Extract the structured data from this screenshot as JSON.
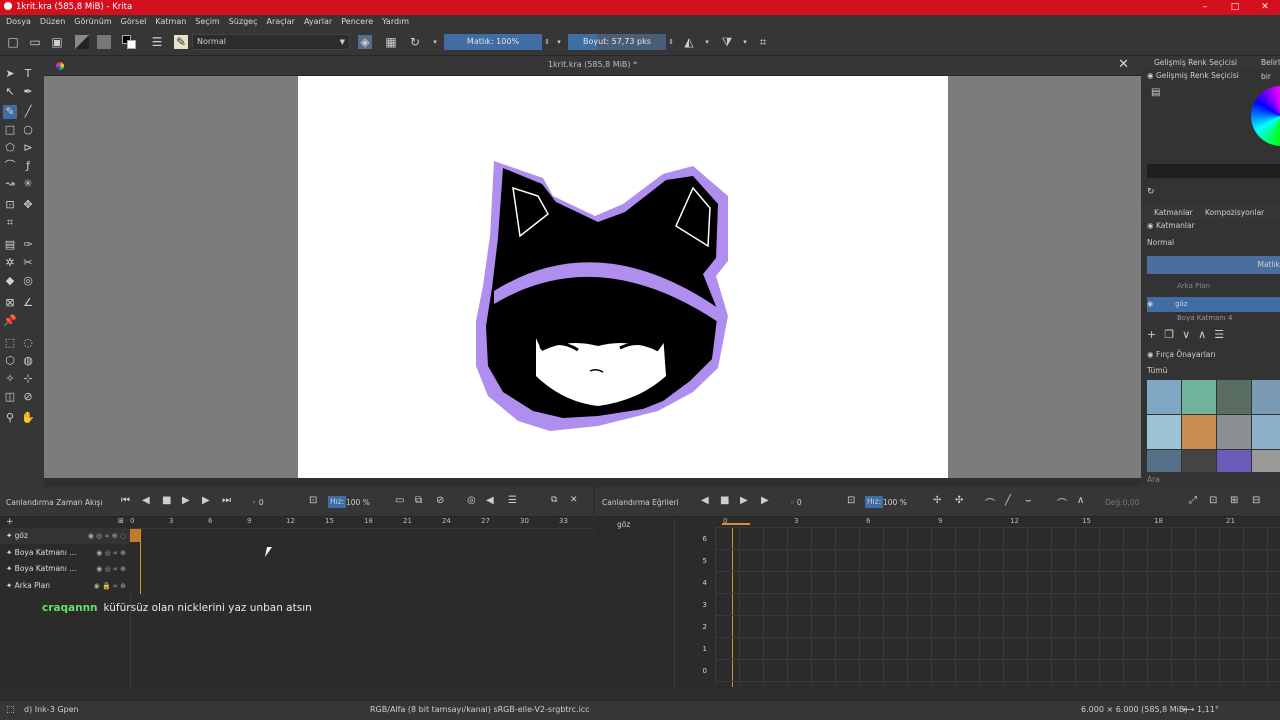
{
  "window": {
    "title": "1krit.kra (585,8 MiB) - Krita",
    "controls": [
      "–",
      "□",
      "✕"
    ]
  },
  "menu": [
    "Dosya",
    "Düzen",
    "Görünüm",
    "Görsel",
    "Katman",
    "Seçim",
    "Süzgeç",
    "Araçlar",
    "Ayarlar",
    "Pencere",
    "Yardım"
  ],
  "toolbar": {
    "blend_mode": "Normal",
    "opacity_label": "Matlık: 100%",
    "opacity_value": 1.0,
    "size_label": "Boyut: 57,73 pks",
    "size_fill": 0.3
  },
  "document": {
    "tab_title": "1krit.kra (585,8 MiB) *"
  },
  "right_dock": {
    "advanced_color_tab": "Gelişmiş Renk Seçicisi",
    "specific_color_tab": "Belirli bir",
    "advanced_color_header": "Gelişmiş Renk Seçicisi",
    "layers_tab": "Katmanlar",
    "composition_tab": "Kompozisyonlar",
    "layers_header": "Katmanlar",
    "blend": "Normal",
    "opacity": "Matlık",
    "layers": [
      "Arka Plan",
      "göz",
      "Boya Katmanı 4"
    ],
    "brush_presets_header": "Fırça Önayarları",
    "brush_filter": "Tümü",
    "search": "Ara"
  },
  "timeline": {
    "title": "Canlandırma Zaman Akışı",
    "frame": "0",
    "speed_label": "Hız:",
    "speed": "100 %",
    "ruler": [
      "0",
      "3",
      "6",
      "9",
      "12",
      "15",
      "18",
      "21",
      "24",
      "27",
      "30",
      "33"
    ],
    "layers": [
      "göz",
      "Boya Katmanı ...",
      "Boya Katmanı ...",
      "Arka Plan"
    ]
  },
  "curves": {
    "title": "Canlandırma Eğrileri",
    "frame": "0",
    "speed_label": "Hız:",
    "speed": "100 %",
    "value_placeholder": "Değ:0,00",
    "channel": "göz",
    "ruler": [
      "0",
      "3",
      "6",
      "9",
      "12",
      "15",
      "18",
      "21"
    ],
    "yticks": [
      "6",
      "5",
      "4",
      "3",
      "2",
      "1",
      "0"
    ]
  },
  "chat": {
    "user": "craqannn",
    "message": "küfürsüz olan nicklerini yaz unban atsın"
  },
  "status": {
    "brush": "d) Ink-3 Gpen",
    "color": "RGB/Alfa (8 bit tamsayı/kanal) sRGB-elle-V2-srgbtrc.icc",
    "dims": "6.000 × 6.000 (585,8 MiB)",
    "rotation": "1,11°"
  },
  "colors": {
    "title_red": "#d4101f",
    "accent_blue": "#3f6da4",
    "hair_purple": "#b08ef0",
    "chat_green": "#66e066"
  }
}
